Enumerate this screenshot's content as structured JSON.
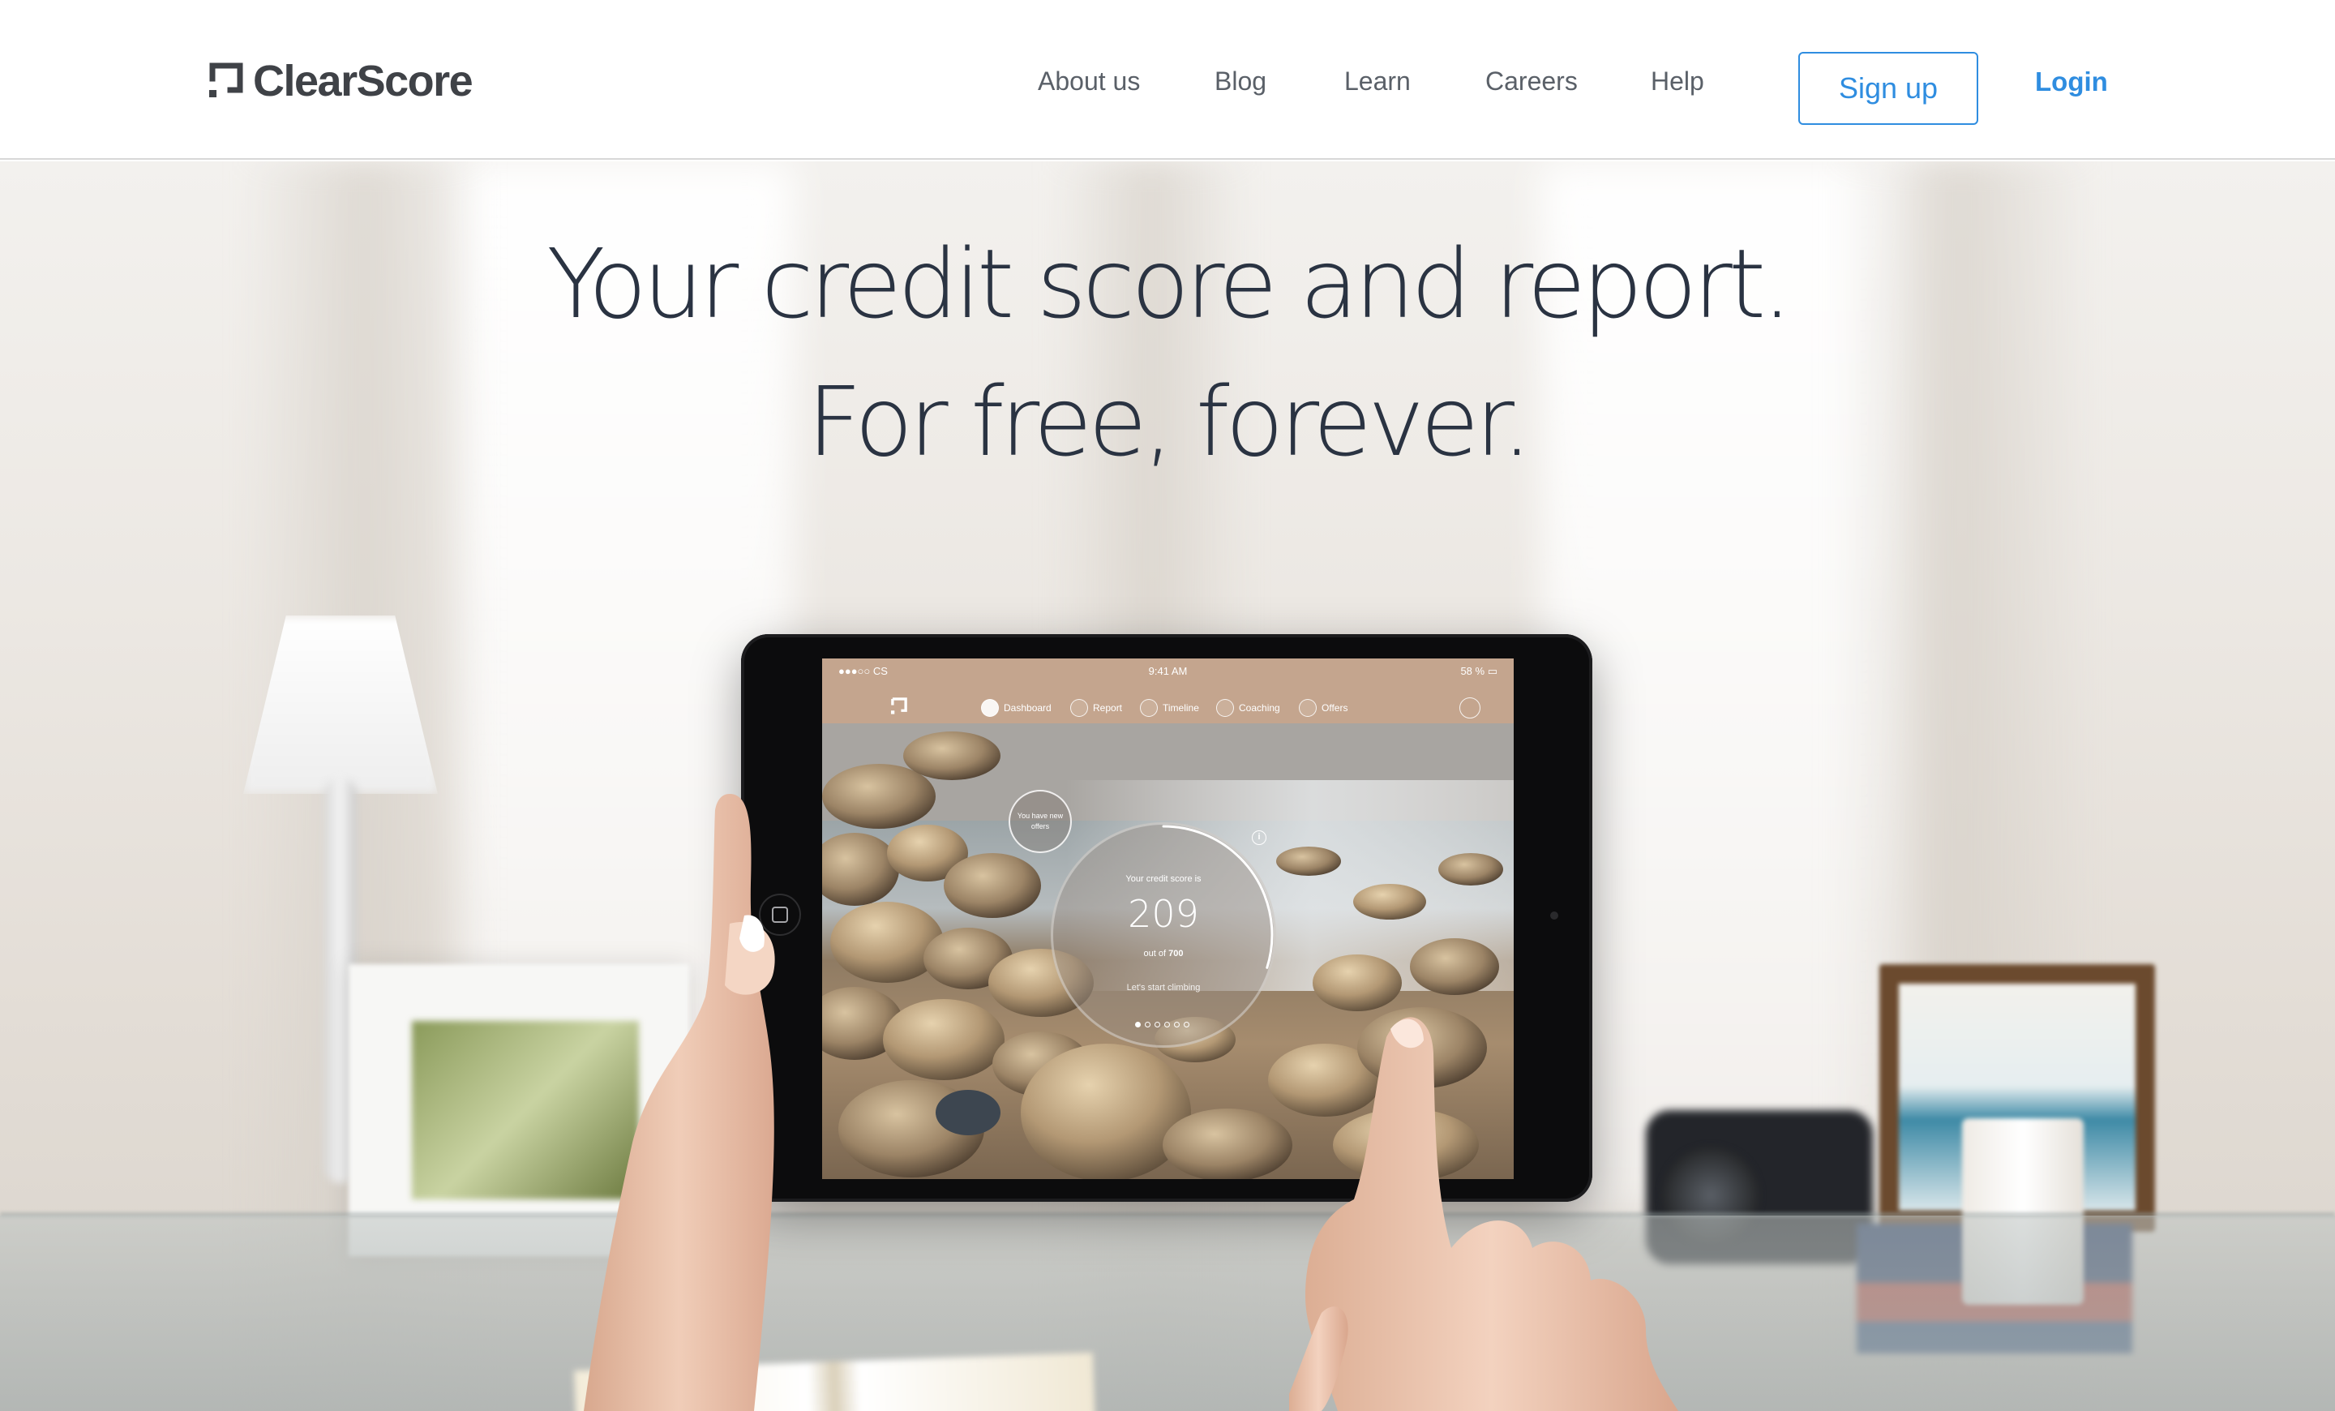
{
  "header": {
    "logo_text": "ClearScore",
    "nav": [
      {
        "label": "About us"
      },
      {
        "label": "Blog"
      },
      {
        "label": "Learn"
      },
      {
        "label": "Careers"
      },
      {
        "label": "Help"
      }
    ],
    "signup_label": "Sign up",
    "login_label": "Login"
  },
  "hero": {
    "line1": "Your credit score and report.",
    "line2": "For free, forever."
  },
  "tablet": {
    "status": {
      "carrier": "●●●○○ CS ",
      "time": "9:41 AM",
      "battery": "58 %"
    },
    "nav": [
      {
        "label": "Dashboard",
        "icon": "dashboard-icon"
      },
      {
        "label": "Report",
        "icon": "report-icon"
      },
      {
        "label": "Timeline",
        "icon": "timeline-icon"
      },
      {
        "label": "Coaching",
        "icon": "coaching-icon"
      },
      {
        "label": "Offers",
        "icon": "offers-icon"
      }
    ],
    "offer_bubble": "You have new offers",
    "score_caption": "Your credit score is",
    "score_value": "209",
    "score_outof_prefix": "out of ",
    "score_outof_value": "700",
    "score_cta": "Let's start climbing",
    "score_fraction": 0.2986
  },
  "colors": {
    "accent": "#2f8de0",
    "headline": "#2a3342",
    "logo": "#3f4247"
  }
}
